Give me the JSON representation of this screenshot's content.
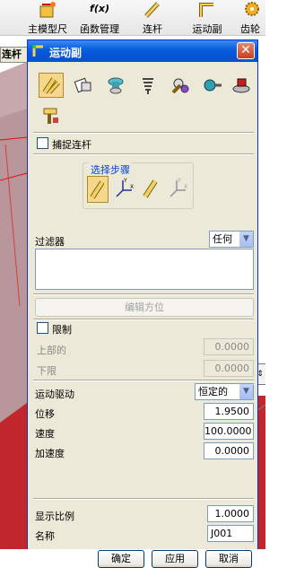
{
  "toolbar": {
    "items": [
      {
        "label": "主模型尺",
        "icon": "model-dimension-icon"
      },
      {
        "label": "函数管理",
        "icon": "function-manager-icon"
      },
      {
        "label": "连杆",
        "icon": "link-icon"
      },
      {
        "label": "运动副",
        "icon": "joint-icon"
      },
      {
        "label": "齿轮",
        "icon": "gear-icon"
      }
    ],
    "formula_glyph": "f(x)"
  },
  "background": {
    "tab_label": "连杆",
    "scroll_stub_glyph": "⇕"
  },
  "dialog": {
    "title": "运动副",
    "close_glyph": "✕",
    "joint_types": [
      {
        "name": "revolute-joint-icon",
        "selected": true
      },
      {
        "name": "slider-joint-icon",
        "selected": false
      },
      {
        "name": "cylindrical-joint-icon",
        "selected": false
      },
      {
        "name": "screw-joint-icon",
        "selected": false
      },
      {
        "name": "universal-joint-icon",
        "selected": false
      },
      {
        "name": "spherical-joint-icon",
        "selected": false
      },
      {
        "name": "planar-joint-icon",
        "selected": false
      },
      {
        "name": "fixed-joint-icon",
        "selected": false
      }
    ],
    "snap_link_label": "捕捉连杆",
    "selection_steps": {
      "title": "选择步骤",
      "steps": [
        "first-link-step-icon",
        "first-origin-step-icon",
        "second-link-step-icon",
        "second-origin-step-icon"
      ]
    },
    "filter": {
      "label": "过滤器",
      "value": "任何"
    },
    "edit_orientation_label": "编辑方位",
    "limits": {
      "label": "限制",
      "upper_label": "上部的",
      "upper_value": "0.0000",
      "lower_label": "下限",
      "lower_value": "0.0000"
    },
    "driver": {
      "label": "运动驱动",
      "value": "恒定的",
      "displacement_label": "位移",
      "displacement_value": "1.9500",
      "velocity_label": "速度",
      "velocity_value": "100.0000",
      "acceleration_label": "加速度",
      "acceleration_value": "0.0000"
    },
    "display_scale": {
      "label": "显示比例",
      "value": "1.0000"
    },
    "name": {
      "label": "名称",
      "value": "J001"
    },
    "buttons": {
      "ok": "确定",
      "apply": "应用",
      "cancel": "取消"
    }
  },
  "colors": {
    "titlebar": "#0a5fdd",
    "dialog_bg": "#ece9d8",
    "background_red": "#c0282e",
    "selected_icon_bg": "#f5d88c",
    "group_title": "#0046d5"
  }
}
